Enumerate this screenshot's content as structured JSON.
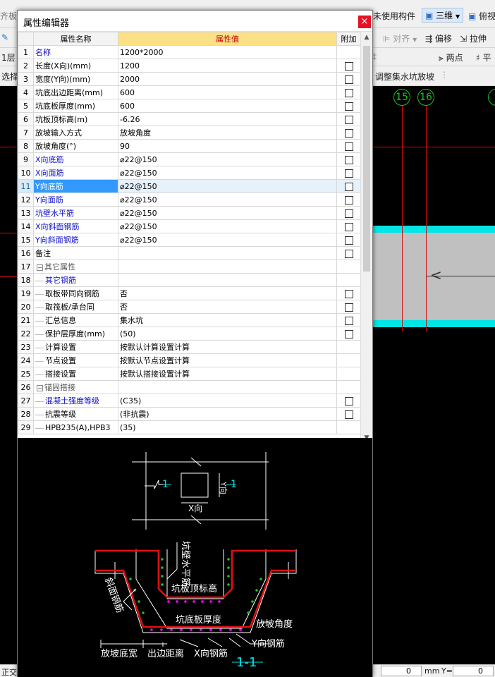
{
  "background": {
    "toolbar1": {
      "partial_left": "齐板",
      "unused_components": "未使用构件",
      "view_3d": "三维",
      "view_top": "俯视"
    },
    "toolbar2": {
      "align": "对齐",
      "offset": "偏移",
      "stretch": "拉伸"
    },
    "toolbar3": {
      "floor": "1层",
      "two_points": "两点",
      "parallel_partial": "平"
    },
    "toolbar4": {
      "select": "选择",
      "adjust_pit_slope": "调整集水坑放坡"
    },
    "grid_axes": [
      "15",
      "16"
    ],
    "status_left": "正交",
    "status_x_label": "mm",
    "status_y_label": "Y=",
    "status_x_value": "0",
    "status_y_value": "0"
  },
  "dialog": {
    "title": "属性编辑器",
    "close_icon": "close-icon",
    "columns": {
      "name": "属性名称",
      "value": "属性值",
      "addon": "附加"
    },
    "rows": [
      {
        "idx": "1",
        "name": "名称",
        "value": "1200*2000",
        "style": "blue",
        "check": false
      },
      {
        "idx": "2",
        "name": "长度(X向)(mm)",
        "value": "1200",
        "style": "",
        "check": true
      },
      {
        "idx": "3",
        "name": "宽度(Y向)(mm)",
        "value": "2000",
        "style": "",
        "check": true
      },
      {
        "idx": "4",
        "name": "坑底出边距离(mm)",
        "value": "600",
        "style": "",
        "check": true
      },
      {
        "idx": "5",
        "name": "坑底板厚度(mm)",
        "value": "600",
        "style": "",
        "check": true
      },
      {
        "idx": "6",
        "name": "坑板顶标高(m)",
        "value": "-6.26",
        "style": "",
        "check": true
      },
      {
        "idx": "7",
        "name": "放坡输入方式",
        "value": "放坡角度",
        "style": "",
        "check": true
      },
      {
        "idx": "8",
        "name": "放坡角度(°)",
        "value": "90",
        "style": "",
        "check": true
      },
      {
        "idx": "9",
        "name": "X向底筋",
        "value": "⌀22@150",
        "style": "blue",
        "check": true
      },
      {
        "idx": "10",
        "name": "X向面筋",
        "value": "⌀22@150",
        "style": "blue",
        "check": true
      },
      {
        "idx": "11",
        "name": "Y向底筋",
        "value": "⌀22@150",
        "style": "blue",
        "check": true,
        "selected": true
      },
      {
        "idx": "12",
        "name": "Y向面筋",
        "value": "⌀22@150",
        "style": "blue",
        "check": true
      },
      {
        "idx": "13",
        "name": "坑壁水平筋",
        "value": "⌀22@150",
        "style": "blue",
        "check": true
      },
      {
        "idx": "14",
        "name": "X向斜面钢筋",
        "value": "⌀22@150",
        "style": "blue",
        "check": true
      },
      {
        "idx": "15",
        "name": "Y向斜面钢筋",
        "value": "⌀22@150",
        "style": "blue",
        "check": true
      },
      {
        "idx": "16",
        "name": "备注",
        "value": "",
        "style": "",
        "check": true
      },
      {
        "idx": "17",
        "name": "其它属性",
        "value": "",
        "style": "grp",
        "group": true
      },
      {
        "idx": "18",
        "name": "其它钢筋",
        "value": "",
        "style": "blue",
        "child": true
      },
      {
        "idx": "19",
        "name": "取板带同向钢筋",
        "value": "否",
        "style": "",
        "child": true,
        "check": true
      },
      {
        "idx": "20",
        "name": "取筏板/承台同",
        "value": "否",
        "style": "",
        "child": true,
        "check": true
      },
      {
        "idx": "21",
        "name": "汇总信息",
        "value": "集水坑",
        "style": "",
        "child": true,
        "check": true
      },
      {
        "idx": "22",
        "name": "保护层厚度(mm)",
        "value": "(50)",
        "style": "",
        "child": true,
        "check": true
      },
      {
        "idx": "23",
        "name": "计算设置",
        "value": "按默认计算设置计算",
        "style": "",
        "child": true
      },
      {
        "idx": "24",
        "name": "节点设置",
        "value": "按默认节点设置计算",
        "style": "",
        "child": true
      },
      {
        "idx": "25",
        "name": "搭接设置",
        "value": "按默认搭接设置计算",
        "style": "",
        "child": true
      },
      {
        "idx": "26",
        "name": "锚固搭接",
        "value": "",
        "style": "grp",
        "group": true
      },
      {
        "idx": "27",
        "name": "混凝土强度等级",
        "value": "(C35)",
        "style": "blue",
        "child": true,
        "check": true
      },
      {
        "idx": "28",
        "name": "抗震等级",
        "value": "(非抗震)",
        "style": "",
        "child": true,
        "check": true
      },
      {
        "idx": "29",
        "name": "HPB235(A),HPB3",
        "value": "(35)",
        "style": "",
        "child": true
      }
    ]
  },
  "diagram": {
    "plan_label_left": "1",
    "plan_label_right": "1",
    "plan_x_dir": "X向",
    "plan_y_dir": "Y向",
    "wall_horizontal_rebar": "坑壁水平筋",
    "slope_rebar": "斜面钢筋",
    "pit_top_elevation": "坑板顶标高",
    "pit_bottom_thickness": "坑底板厚度",
    "slope_angle": "放坡角度",
    "y_rebar": "Y向钢筋",
    "slope_base_width": "放坡底宽",
    "edge_distance": "出边距离",
    "x_rebar": "X向钢筋",
    "section_label": "1-1"
  },
  "colors": {
    "cad_bg": "#000000",
    "cad_red": "#e01010",
    "cad_green": "#19c41e",
    "cad_cyan": "#00e5e5",
    "cad_magenta": "#ff00ff",
    "header_value_bg": "#fce086",
    "selection_blue": "#3399ff"
  }
}
